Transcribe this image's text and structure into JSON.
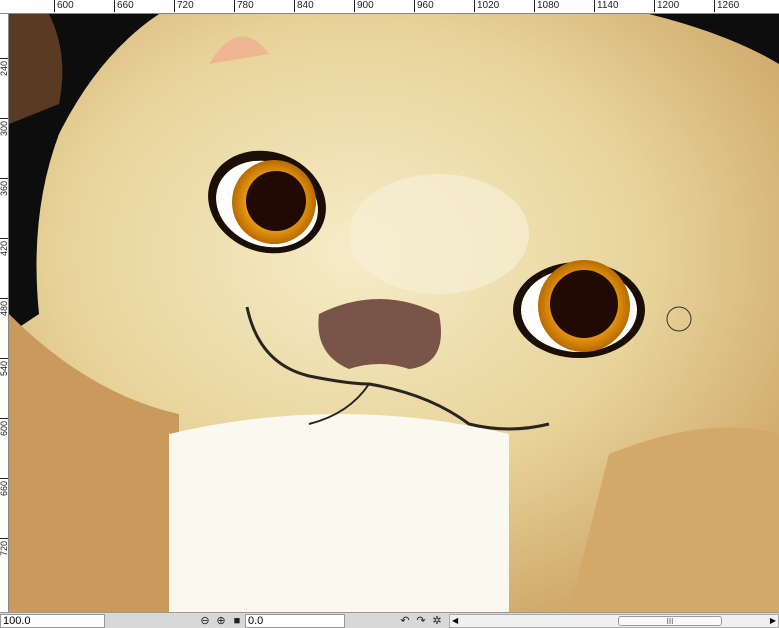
{
  "ruler_h": [
    "600",
    "660",
    "720",
    "780",
    "840",
    "900",
    "960",
    "1020",
    "1080",
    "1140",
    "1200",
    "1260"
  ],
  "ruler_v": [
    "240",
    "300",
    "360",
    "420",
    "480",
    "540",
    "600",
    "660",
    "720"
  ],
  "statusbar": {
    "zoom_value": "100.0",
    "angle_value": "0.0",
    "icons": [
      "zoom-out-icon",
      "zoom-in-icon",
      "fit-view-icon",
      "rotate-left-icon",
      "rotate-right-icon",
      "reset-rotation-icon"
    ],
    "scroll_grip": "III"
  },
  "colors": {
    "fur": "#e6cf92",
    "background": "#0d0d0d",
    "eye": "#f0a020"
  }
}
